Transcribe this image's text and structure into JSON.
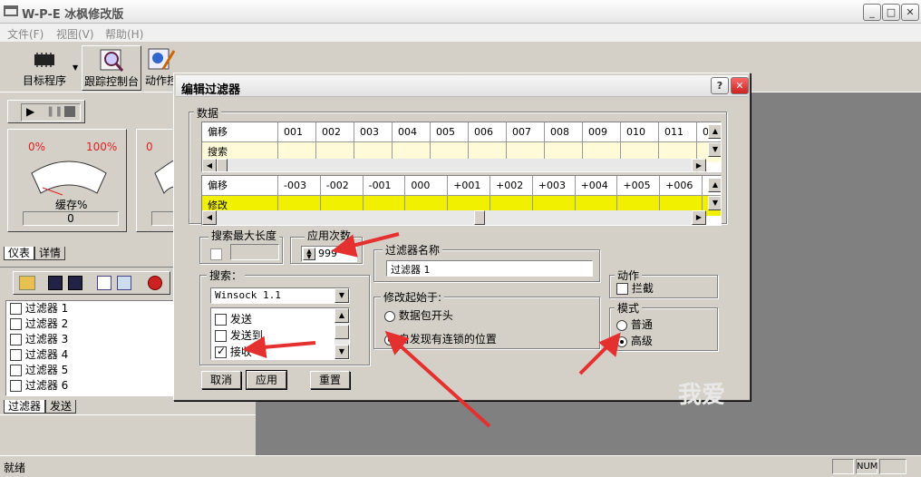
{
  "window": {
    "title": "W-P-E 冰枫修改版"
  },
  "menu": [
    "文件(F)",
    "视图(V)",
    "帮助(H)"
  ],
  "toolbar": {
    "target": "目标程序",
    "trace": "跟踪控制台",
    "action": "动作控"
  },
  "gauge": {
    "min": "0%",
    "max": "100%",
    "caption": "缓存%",
    "value": "0",
    "min2": "0"
  },
  "tabs1": [
    "仪表",
    "详情"
  ],
  "tabs2": [
    "过滤器",
    "发送"
  ],
  "filters": [
    "过滤器 1",
    "过滤器 2",
    "过滤器 3",
    "过滤器 4",
    "过滤器 5",
    "过滤器 6"
  ],
  "status": {
    "ready": "就绪",
    "num": "NUM"
  },
  "dialog": {
    "title": "编辑过滤器",
    "help": "?",
    "data_group": "数据",
    "grid1": {
      "head": "偏移",
      "cols": [
        "001",
        "002",
        "003",
        "004",
        "005",
        "006",
        "007",
        "008",
        "009",
        "010",
        "011",
        "0"
      ],
      "row2": "搜索"
    },
    "grid2": {
      "head": "偏移",
      "cols": [
        "-003",
        "-002",
        "-001",
        "000",
        "+001",
        "+002",
        "+003",
        "+004",
        "+005",
        "+006"
      ],
      "row2": "修改"
    },
    "maxlen_group": "搜索最大长度",
    "times_group": "应用次数",
    "times_value": "999",
    "search_group": "搜索：",
    "search_select": "Winsock 1.1",
    "search_items": [
      "发送",
      "发送到",
      "接收"
    ],
    "name_group": "过滤器名称",
    "name_value": "过滤器 1",
    "start_group": "修改起始于:",
    "start_opts": [
      "数据包开头",
      "自发现有连锁的位置"
    ],
    "action_group": "动作",
    "action_intercept": "拦截",
    "mode_group": "模式",
    "mode_opts": [
      "普通",
      "高级"
    ],
    "cancel": "取消",
    "apply": "应用",
    "reset": "重置",
    "watermark": "我爱"
  }
}
